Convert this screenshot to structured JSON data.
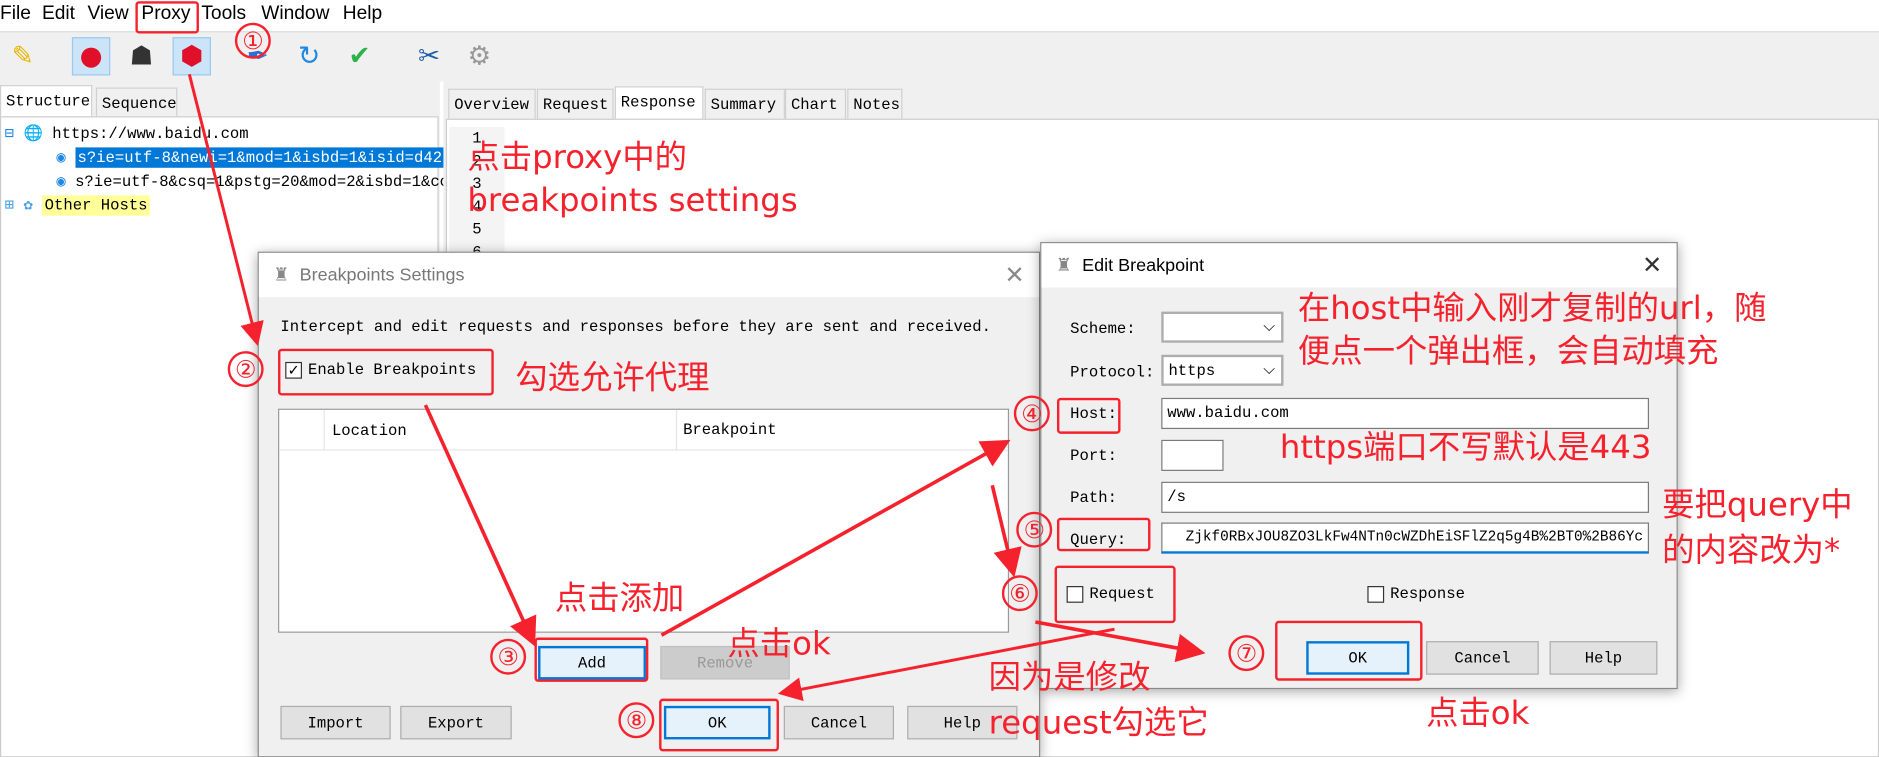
{
  "menu": [
    "File",
    "Edit",
    "View",
    "Proxy",
    "Tools",
    "Window",
    "Help"
  ],
  "toolbar_icons": [
    "broom-icon",
    "record-icon",
    "turtle-icon",
    "breakpoint-icon",
    "pen-icon",
    "refresh-icon",
    "check-icon",
    "tools-icon",
    "gear-icon"
  ],
  "left_tabs": [
    "Structure",
    "Sequence"
  ],
  "tree": {
    "host": "https://www.baidu.com",
    "items": [
      "s?ie=utf-8&newi=1&mod=1&isbd=1&isid=d42",
      "s?ie=utf-8&csq=1&pstg=20&mod=2&isbd=1&cc"
    ],
    "other": "Other Hosts"
  },
  "right_tabs": [
    "Overview",
    "Request",
    "Response",
    "Summary",
    "Chart",
    "Notes"
  ],
  "line_numbers": [
    "1",
    "2",
    "3",
    "4",
    "5",
    "6"
  ],
  "breakpoints_dialog": {
    "title": "Breakpoints Settings",
    "description": "Intercept and edit requests and responses before they are sent and received.",
    "enable_label": "Enable Breakpoints",
    "enable_checked": true,
    "columns": [
      "Location",
      "Breakpoint"
    ],
    "add": "Add",
    "remove": "Remove",
    "import": "Import",
    "export": "Export",
    "ok": "OK",
    "cancel": "Cancel",
    "help": "Help"
  },
  "edit_dialog": {
    "title": "Edit Breakpoint",
    "scheme_label": "Scheme:",
    "scheme_value": "",
    "protocol_label": "Protocol:",
    "protocol_value": "https",
    "host_label": "Host:",
    "host_value": "www.baidu.com",
    "port_label": "Port:",
    "port_value": "",
    "path_label": "Path:",
    "path_value": "/s",
    "query_label": "Query:",
    "query_value": "Zjkf0RBxJOU8ZO3LkFw4NTn0cWZDhEiSFlZ2q5g4B%2BT0%2B86Yc",
    "request_label": "Request",
    "request_checked": false,
    "response_label": "Response",
    "response_checked": false,
    "ok": "OK",
    "cancel": "Cancel",
    "help": "Help"
  },
  "annotations": {
    "a1": "点击proxy中的",
    "a1b": "breakpoints settings",
    "a2": "勾选允许代理",
    "a3": "点击添加",
    "a4": "点击ok",
    "a5": "在host中输入刚才复制的url，随",
    "a5b": "便点一个弹出框，会自动填充",
    "a6": "https端口不写默认是443",
    "a7": "要把query中",
    "a7b": "的内容改为*",
    "a8": "因为是修改",
    "a8b": "request勾选它",
    "a9": "点击ok",
    "steps": [
      "①",
      "②",
      "③",
      "④",
      "⑤",
      "⑥",
      "⑦",
      "⑧"
    ],
    "color": "#f5222d"
  }
}
